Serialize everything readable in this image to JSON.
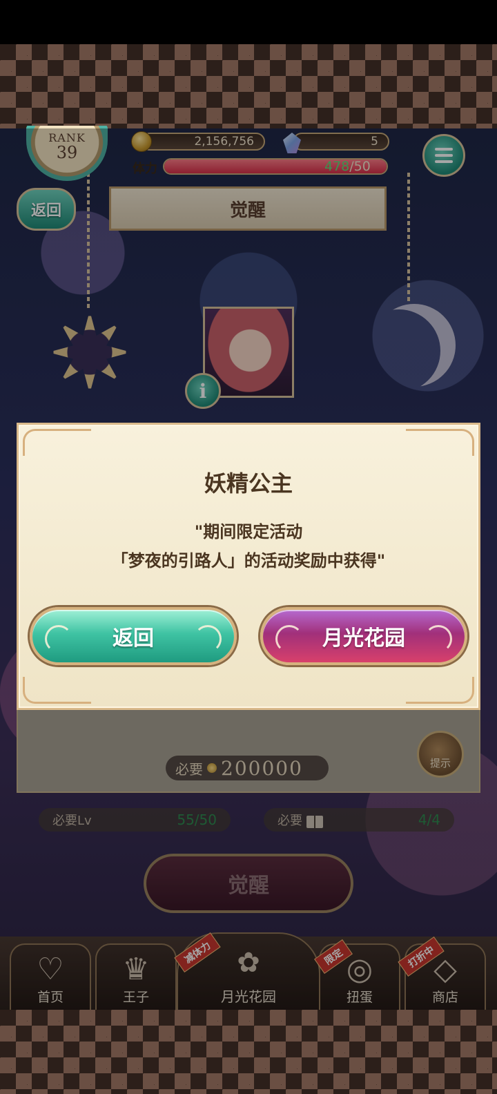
{
  "hud": {
    "rank_label": "RANK",
    "rank_value": "39",
    "coins": "2,156,756",
    "gems": "5",
    "stamina_label": "体力",
    "stamina_current": "478",
    "stamina_max": "/50",
    "stamina_fill_percent": 100
  },
  "header": {
    "back_label": "返回",
    "title": "觉醒"
  },
  "panel": {
    "hint_label": "提示",
    "cost_label": "必要",
    "cost_value": "200000",
    "req_level_label": "必要Lv",
    "req_level_value": "55/50",
    "req_book_label": "必要",
    "req_book_value": "4/4",
    "awaken_label": "觉醒"
  },
  "dialog": {
    "title": "妖精公主",
    "message_line1": "\"期间限定活动",
    "message_line2": "「梦夜的引路人」的活动奖励中获得\"",
    "back_button": "返回",
    "garden_button": "月光花园"
  },
  "nav": {
    "items": [
      {
        "label": "首页",
        "icon": "heart-icon"
      },
      {
        "label": "王子",
        "icon": "crown-icon"
      },
      {
        "label": "月光花园",
        "icon": "garden-icon",
        "ribbon": "减体力"
      },
      {
        "label": "扭蛋",
        "icon": "gacha-icon",
        "ribbon": "限定"
      },
      {
        "label": "商店",
        "icon": "shop-icon",
        "ribbon": "打折中"
      }
    ]
  },
  "colors": {
    "teal_button": "#3fc3a3",
    "magenta_button": "#a1307a",
    "dialog_bg": "#f8f1dc",
    "stamina_value": "#5ee07a"
  }
}
